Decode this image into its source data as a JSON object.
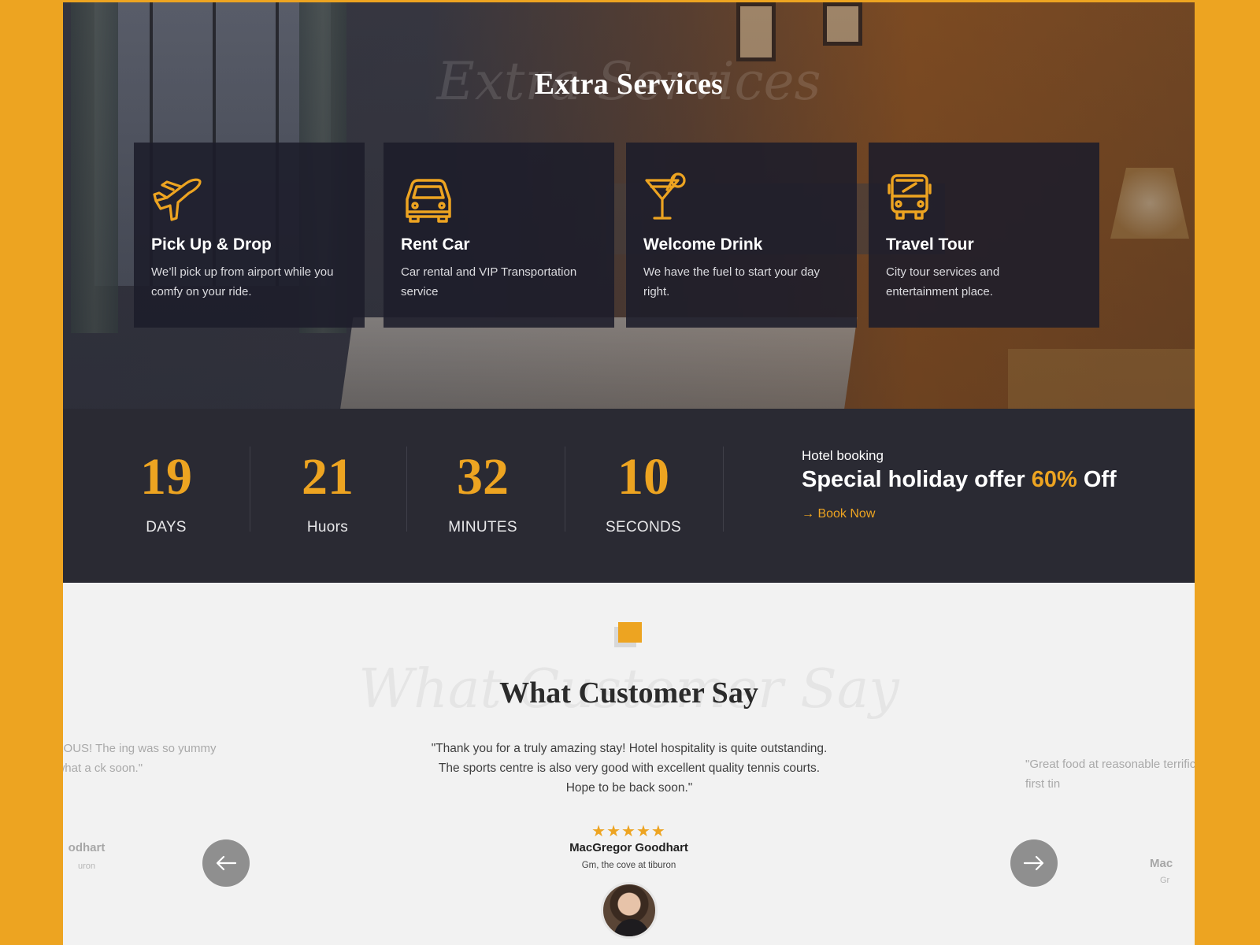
{
  "extra_services": {
    "title": "Extra Services",
    "script_text": "Extra Services",
    "cards": [
      {
        "icon": "airplane-icon",
        "title": "Pick Up & Drop",
        "desc": "We’ll pick up from airport while you comfy on your ride."
      },
      {
        "icon": "car-icon",
        "title": "Rent Car",
        "desc": "Car rental and VIP Transportation service"
      },
      {
        "icon": "cocktail-icon",
        "title": "Welcome Drink",
        "desc": "We have the fuel to start your day right."
      },
      {
        "icon": "bus-icon",
        "title": "Travel Tour",
        "desc": "City tour services and entertainment place."
      }
    ]
  },
  "countdown": {
    "units": [
      {
        "value": "19",
        "label": "DAYS"
      },
      {
        "value": "21",
        "label": "Huors"
      },
      {
        "value": "32",
        "label": "MINUTES"
      },
      {
        "value": "10",
        "label": "SECONDS"
      }
    ],
    "offer": {
      "kicker": "Hotel booking",
      "title_prefix": "Special holiday offer",
      "title_accent": "60%",
      "title_suffix": "Off",
      "link_label": "Book Now"
    }
  },
  "testimonials": {
    "title": "What Customer Say",
    "script_text": "What Customer Say",
    "active": {
      "quote": "\"Thank you for a truly amazing stay! Hotel hospitality is quite outstanding. The sports centre is also very good with excellent quality tennis courts. Hope to be back soon.\"",
      "rating": "★★★★★",
      "name": "MacGregor Goodhart",
      "role": "Gm, the cove at tiburon"
    },
    "prev_partial": {
      "quote": "ek. It was FABULOUS! The ing was so yummy – what a ck soon.\"",
      "name": "odhart",
      "role": "uron"
    },
    "next_partial": {
      "quote": "\"Great food at reasonable terrific. This was my first tin",
      "name": "Mac",
      "role": "Gr"
    }
  },
  "colors": {
    "accent": "#EDA421",
    "dark_band": "#2a2a33",
    "card_bg": "#1c1c2a",
    "page_bg": "#f2f2f2"
  }
}
